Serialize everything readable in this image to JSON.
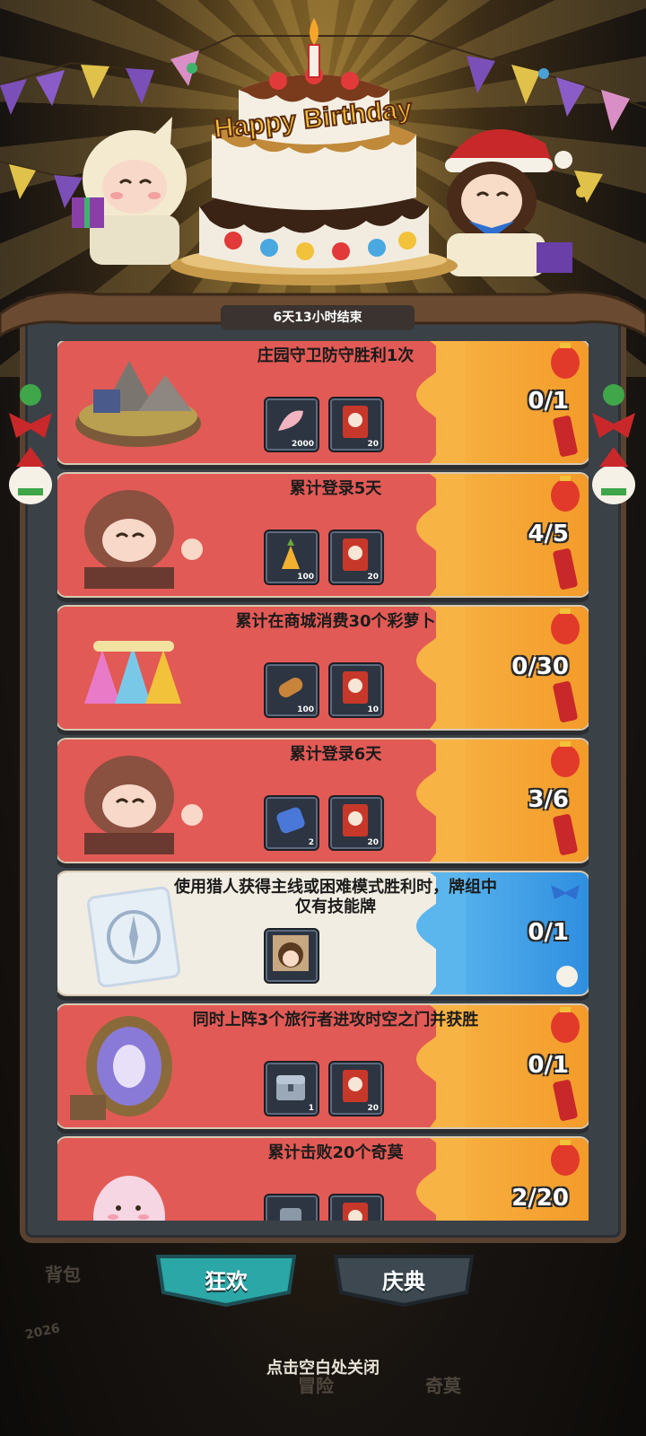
{
  "header": {
    "timer": "6天13小时结束",
    "cake_text": "Happy Birthday"
  },
  "tasks": [
    {
      "title": "庄园守卫防守胜利1次",
      "progress": "0/1",
      "style": "red",
      "rewards": [
        {
          "icon": "feather-icon",
          "count": "2000"
        },
        {
          "icon": "red-card-icon",
          "count": "20"
        }
      ]
    },
    {
      "title": "累计登录5天",
      "progress": "4/5",
      "style": "red",
      "rewards": [
        {
          "icon": "golden-carrot-icon",
          "count": "100"
        },
        {
          "icon": "red-card-icon",
          "count": "20"
        }
      ]
    },
    {
      "title": "累计在商城消费30个彩萝卜",
      "progress": "0/30",
      "style": "red",
      "rewards": [
        {
          "icon": "bread-icon",
          "count": "100"
        },
        {
          "icon": "red-card-icon",
          "count": "10"
        }
      ]
    },
    {
      "title": "累计登录6天",
      "progress": "3/6",
      "style": "red",
      "rewards": [
        {
          "icon": "blue-scroll-icon",
          "count": "2"
        },
        {
          "icon": "red-card-icon",
          "count": "20"
        }
      ]
    },
    {
      "title": "使用猎人获得主线或困难模式胜利时，牌组中仅有技能牌",
      "progress": "0/1",
      "style": "blue",
      "rewards": [
        {
          "icon": "hunter-portrait-icon",
          "count": ""
        }
      ]
    },
    {
      "title": "同时上阵3个旅行者进攻时空之门并获胜",
      "progress": "0/1",
      "style": "red",
      "rewards": [
        {
          "icon": "silver-chest-icon",
          "count": "1"
        },
        {
          "icon": "red-card-icon",
          "count": "20"
        }
      ]
    },
    {
      "title": "累计击败20个奇莫",
      "progress": "2/20",
      "style": "red",
      "rewards": [
        {
          "icon": "reward-icon",
          "count": ""
        },
        {
          "icon": "red-card-icon",
          "count": ""
        }
      ]
    }
  ],
  "tabs": [
    {
      "label": "狂欢"
    },
    {
      "label": "庆典"
    }
  ],
  "close_hint": "点击空白处关闭",
  "background_nav": {
    "bag": "背包",
    "adventure": "冒险",
    "qimo": "奇莫",
    "year": "2026"
  },
  "colors": {
    "card_red": "#e25a55",
    "card_orange": "#f7b343",
    "card_blue": "#2f8fe0",
    "tab_teal": "#2aa7a6"
  }
}
